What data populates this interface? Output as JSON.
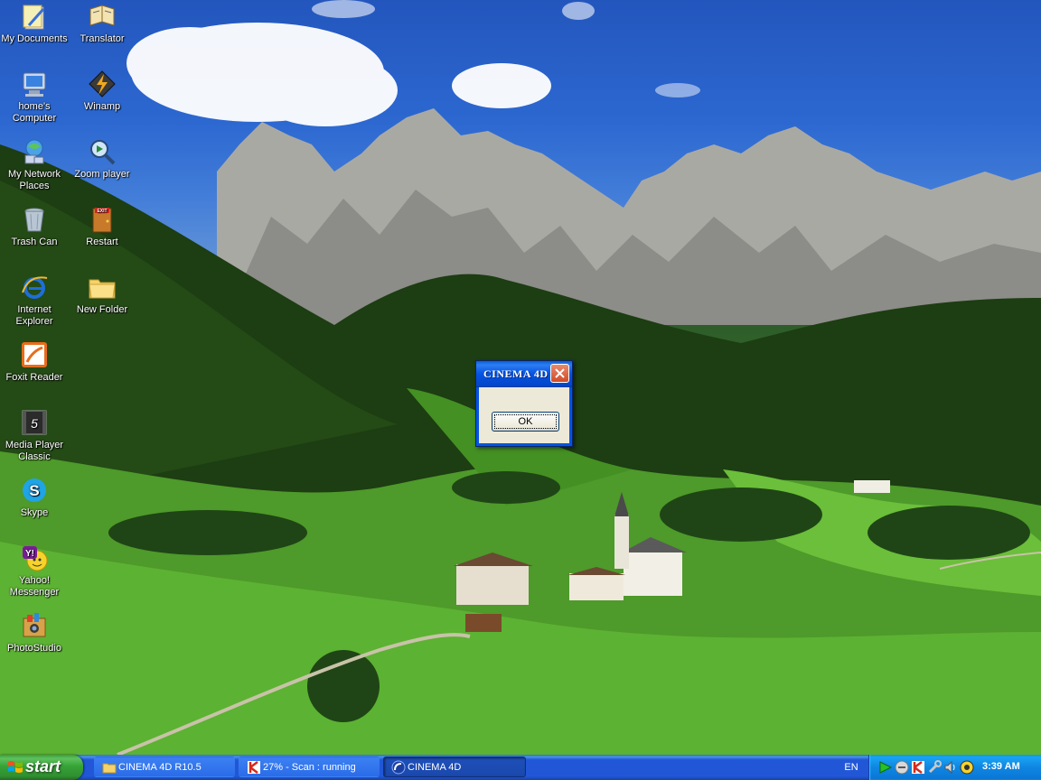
{
  "desktop": {
    "icons": [
      {
        "label": "My Documents"
      },
      {
        "label": "Translator"
      },
      {
        "label": "home's\nComputer"
      },
      {
        "label": "Winamp"
      },
      {
        "label": "My Network\nPlaces"
      },
      {
        "label": "Zoom player"
      },
      {
        "label": "Trash Can"
      },
      {
        "label": "Restart"
      },
      {
        "label": "Internet\nExplorer"
      },
      {
        "label": "New Folder"
      },
      {
        "label": "Foxit Reader"
      },
      {
        "label": "Media Player\nClassic"
      },
      {
        "label": "Skype"
      },
      {
        "label": "Yahoo!\nMessenger"
      },
      {
        "label": "PhotoStudio"
      }
    ]
  },
  "dialog": {
    "title": "CINEMA 4D",
    "ok_label": "OK"
  },
  "taskbar": {
    "start_label": "start",
    "tasks": [
      {
        "label": "CINEMA 4D R10.5",
        "icon": "folder-icon"
      },
      {
        "label": "27% - Scan : running",
        "icon": "kaspersky-icon"
      },
      {
        "label": "CINEMA 4D",
        "icon": "cinema4d-icon"
      }
    ],
    "language": "EN",
    "clock": "3:39 AM"
  },
  "colors": {
    "taskbar_blue": "#2157d7",
    "start_green": "#37a337",
    "tray_blue": "#0f86e1",
    "dialog_face": "#ece9d8"
  }
}
